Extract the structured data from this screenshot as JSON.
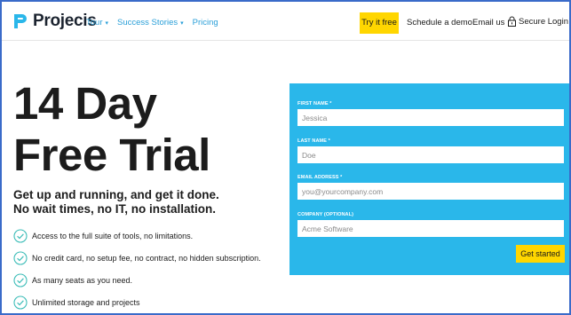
{
  "header": {
    "logo_text": "Projecis",
    "nav": [
      {
        "label": "Tour",
        "dropdown": true
      },
      {
        "label": "Success Stories",
        "dropdown": true
      },
      {
        "label": "Pricing",
        "dropdown": false
      }
    ],
    "try_label": "Try it free",
    "schedule_label": "Schedule a demo",
    "email_label": "Email us",
    "login_label": "Secure Login"
  },
  "hero": {
    "title_line1": "14 Day",
    "title_line2": "Free Trial",
    "subtitle_line1": "Get up and running, and get it done.",
    "subtitle_line2": "No wait times, no IT, no installation.",
    "features": [
      "Access to the full suite of tools, no limitations.",
      "No credit card, no setup fee, no contract, no hidden subscription.",
      "As many seats as you need.",
      "Unlimited storage and projects"
    ]
  },
  "form": {
    "first_name_label": "FIRST NAME *",
    "first_name_placeholder": "Jessica",
    "last_name_label": "LAST NAME *",
    "last_name_placeholder": "Doe",
    "email_label": "EMAIL ADDRESS *",
    "email_placeholder": "you@yourcompany.com",
    "company_label": "COMPANY (OPTIONAL)",
    "company_placeholder": "Acme Software",
    "submit_label": "Get started"
  },
  "colors": {
    "accent_blue": "#2ab7ea",
    "cta_yellow": "#ffd600",
    "link_blue": "#2a9fd8",
    "check_teal": "#3dbdb8"
  }
}
